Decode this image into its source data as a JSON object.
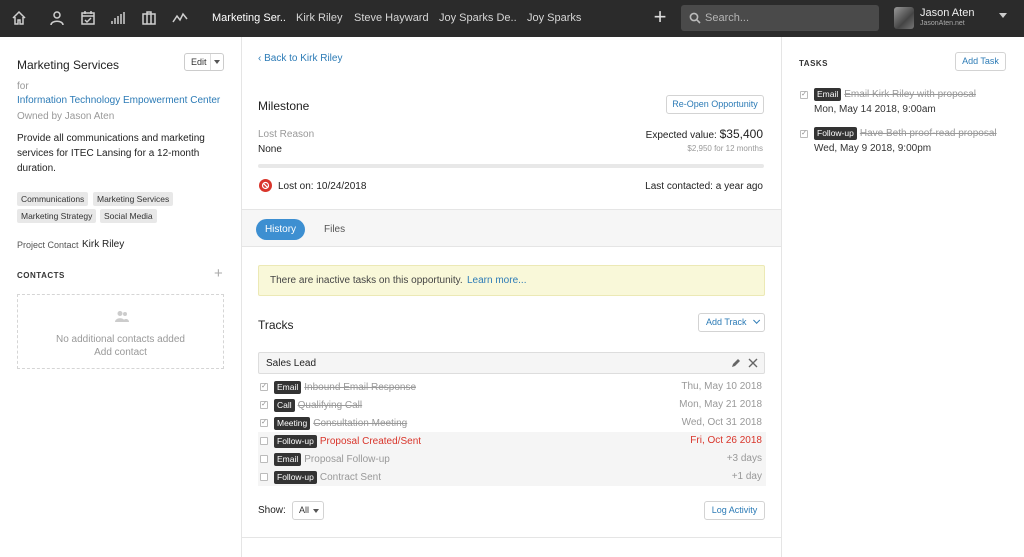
{
  "nav": {
    "icons": [
      "home-icon",
      "user-icon",
      "calendar-check-icon",
      "bar-chart-icon",
      "briefcase-icon",
      "activity-icon"
    ],
    "tabs": [
      "Marketing Ser..",
      "Kirk Riley",
      "Steve Hayward",
      "Joy Sparks De..",
      "Joy Sparks"
    ],
    "search_placeholder": "Search...",
    "user": {
      "name": "Jason Aten",
      "site": "JasonAten.net"
    }
  },
  "left": {
    "title": "Marketing Services",
    "edit_label": "Edit",
    "for_label": "for",
    "company": "Information Technology Empowerment Center",
    "owned_by": "Owned by Jason Aten",
    "description": "Provide all communications and marketing services for ITEC Lansing for a 12-month duration.",
    "tags": [
      "Communications",
      "Marketing Services",
      "Marketing Strategy",
      "Social Media"
    ],
    "project_contact_label": "Project Contact",
    "project_contact_value": "Kirk Riley",
    "contacts_heading": "CONTACTS",
    "no_contacts": "No additional contacts added",
    "add_contact": "Add contact"
  },
  "center": {
    "back_link": "‹ Back to Kirk Riley",
    "milestone": "Milestone",
    "reopen_label": "Re-Open Opportunity",
    "lost_reason_label": "Lost Reason",
    "lost_reason_value": "None",
    "expected_label": "Expected value:",
    "expected_value": "$35,400",
    "monthly": "$2,950 for 12 months",
    "lost_on": "Lost on: 10/24/2018",
    "last_contacted": "Last contacted: a year ago",
    "tabs": [
      "History",
      "Files"
    ],
    "notice_text": "There are inactive tasks on this opportunity.",
    "notice_link": "Learn more...",
    "tracks_heading": "Tracks",
    "add_track_label": "Add Track",
    "track_name": "Sales Lead",
    "track_rows": [
      {
        "type": "Email",
        "label": "Inbound Email Response",
        "date": "Thu, May 10 2018"
      },
      {
        "type": "Call",
        "label": "Qualifying Call",
        "date": "Mon, May 21 2018"
      },
      {
        "type": "Meeting",
        "label": "Consultation Meeting",
        "date": "Wed, Oct 31 2018"
      },
      {
        "type": "Follow-up",
        "label": "Proposal Created/Sent",
        "date": "Fri, Oct 26 2018"
      },
      {
        "type": "Email",
        "label": "Proposal Follow-up",
        "date": "+3 days"
      },
      {
        "type": "Follow-up",
        "label": "Contract Sent",
        "date": "+1 day"
      }
    ],
    "show_label": "Show:",
    "show_value": "All",
    "log_activity_label": "Log Activity"
  },
  "right": {
    "tasks_heading": "TASKS",
    "add_task_label": "Add Task",
    "tasks": [
      {
        "type": "Email",
        "label": "Email Kirk Riley with proposal",
        "date": "Mon, May 14 2018, 9:00am"
      },
      {
        "type": "Follow-up",
        "label": "Have Beth proof-read proposal",
        "date": "Wed, May 9 2018, 9:00pm"
      }
    ]
  },
  "colors": {
    "topbar": "#2b2b2b",
    "link": "#2c7bb6",
    "overdue": "#d9352b",
    "notice_bg": "#f9f8d9",
    "tab_active": "#3d8fd1"
  }
}
